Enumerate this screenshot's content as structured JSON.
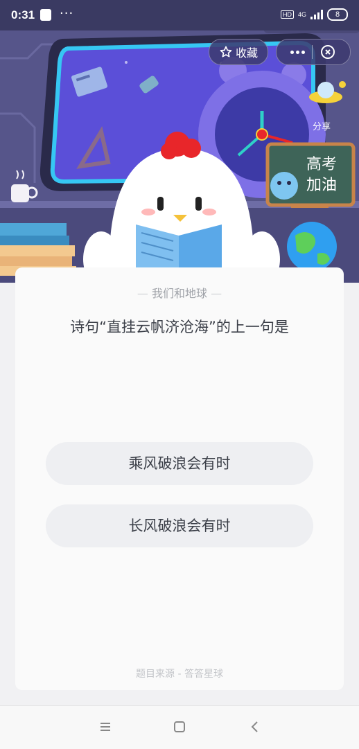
{
  "status_bar": {
    "time": "0:31",
    "network": "4G",
    "hd": "HD",
    "battery": "8"
  },
  "header": {
    "favorite_label": "收藏",
    "share_label": "分享"
  },
  "illustration": {
    "board_text_1": "高考",
    "board_text_2": "加油"
  },
  "quiz": {
    "subject": "我们和地球",
    "question": "诗句“直挂云帆济沧海”的上一句是",
    "options": [
      "乘风破浪会有时",
      "长风破浪会有时"
    ],
    "source": "题目来源 - 答答星球"
  },
  "icons": {
    "status_app": "app-notification-icon",
    "favorite": "star-icon",
    "more": "more-icon",
    "close": "close-target-icon",
    "share": "share-ufo-icon",
    "nav_menu": "menu-icon",
    "nav_home": "home-icon",
    "nav_back": "back-icon"
  },
  "colors": {
    "hero_bg": "#56558a",
    "window_frame": "#2a2a4a",
    "window_glow": "#36c7f3",
    "comb_red": "#e8262a",
    "card_bg": "#fafafa"
  }
}
